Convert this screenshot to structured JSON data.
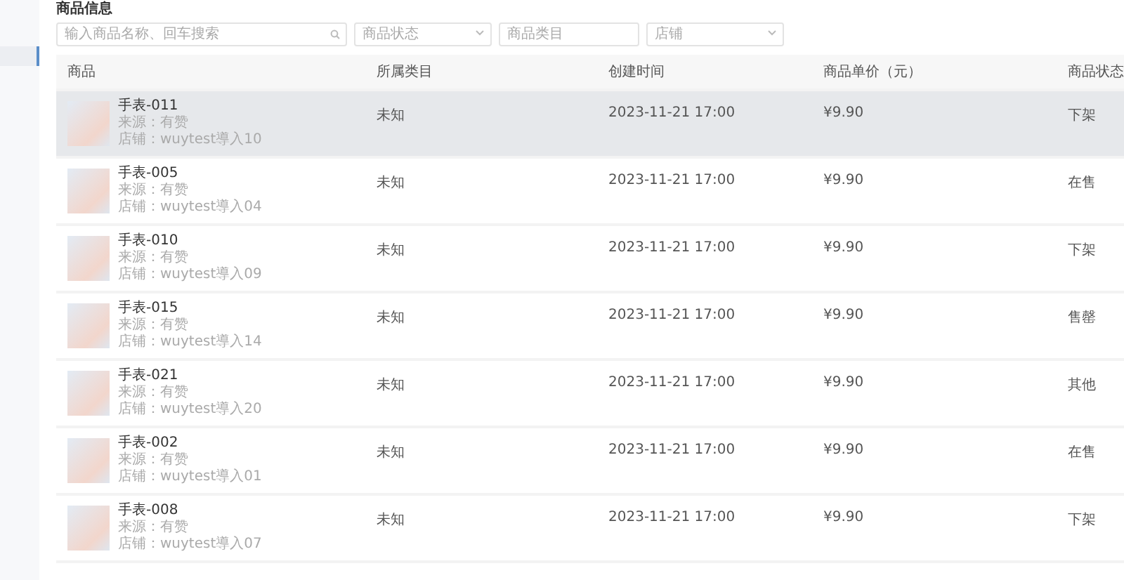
{
  "page_title": "商品信息",
  "filters": [
    {
      "kind": "search",
      "placeholder": "输入商品名称、回车搜索"
    },
    {
      "kind": "select",
      "placeholder": "商品状态"
    },
    {
      "kind": "input",
      "placeholder": "商品类目"
    },
    {
      "kind": "select",
      "placeholder": "店铺"
    }
  ],
  "table": {
    "columns": [
      "商品",
      "所属类目",
      "创建时间",
      "商品单价（元）",
      "商品状态"
    ],
    "rows": [
      {
        "name": "手表-011",
        "source": "来源：有赞",
        "shop": "店铺：wuytest導入10",
        "category": "未知",
        "created": "2023-11-21 17:00",
        "price": "¥9.90",
        "status": "下架",
        "highlighted": true
      },
      {
        "name": "手表-005",
        "source": "来源：有赞",
        "shop": "店铺：wuytest導入04",
        "category": "未知",
        "created": "2023-11-21 17:00",
        "price": "¥9.90",
        "status": "在售",
        "highlighted": false
      },
      {
        "name": "手表-010",
        "source": "来源：有赞",
        "shop": "店铺：wuytest導入09",
        "category": "未知",
        "created": "2023-11-21 17:00",
        "price": "¥9.90",
        "status": "下架",
        "highlighted": false
      },
      {
        "name": "手表-015",
        "source": "来源：有赞",
        "shop": "店铺：wuytest導入14",
        "category": "未知",
        "created": "2023-11-21 17:00",
        "price": "¥9.90",
        "status": "售罄",
        "highlighted": false
      },
      {
        "name": "手表-021",
        "source": "来源：有赞",
        "shop": "店铺：wuytest導入20",
        "category": "未知",
        "created": "2023-11-21 17:00",
        "price": "¥9.90",
        "status": "其他",
        "highlighted": false
      },
      {
        "name": "手表-002",
        "source": "来源：有赞",
        "shop": "店铺：wuytest導入01",
        "category": "未知",
        "created": "2023-11-21 17:00",
        "price": "¥9.90",
        "status": "在售",
        "highlighted": false
      },
      {
        "name": "手表-008",
        "source": "来源：有赞",
        "shop": "店铺：wuytest導入07",
        "category": "未知",
        "created": "2023-11-21 17:00",
        "price": "¥9.90",
        "status": "下架",
        "highlighted": false
      }
    ]
  }
}
